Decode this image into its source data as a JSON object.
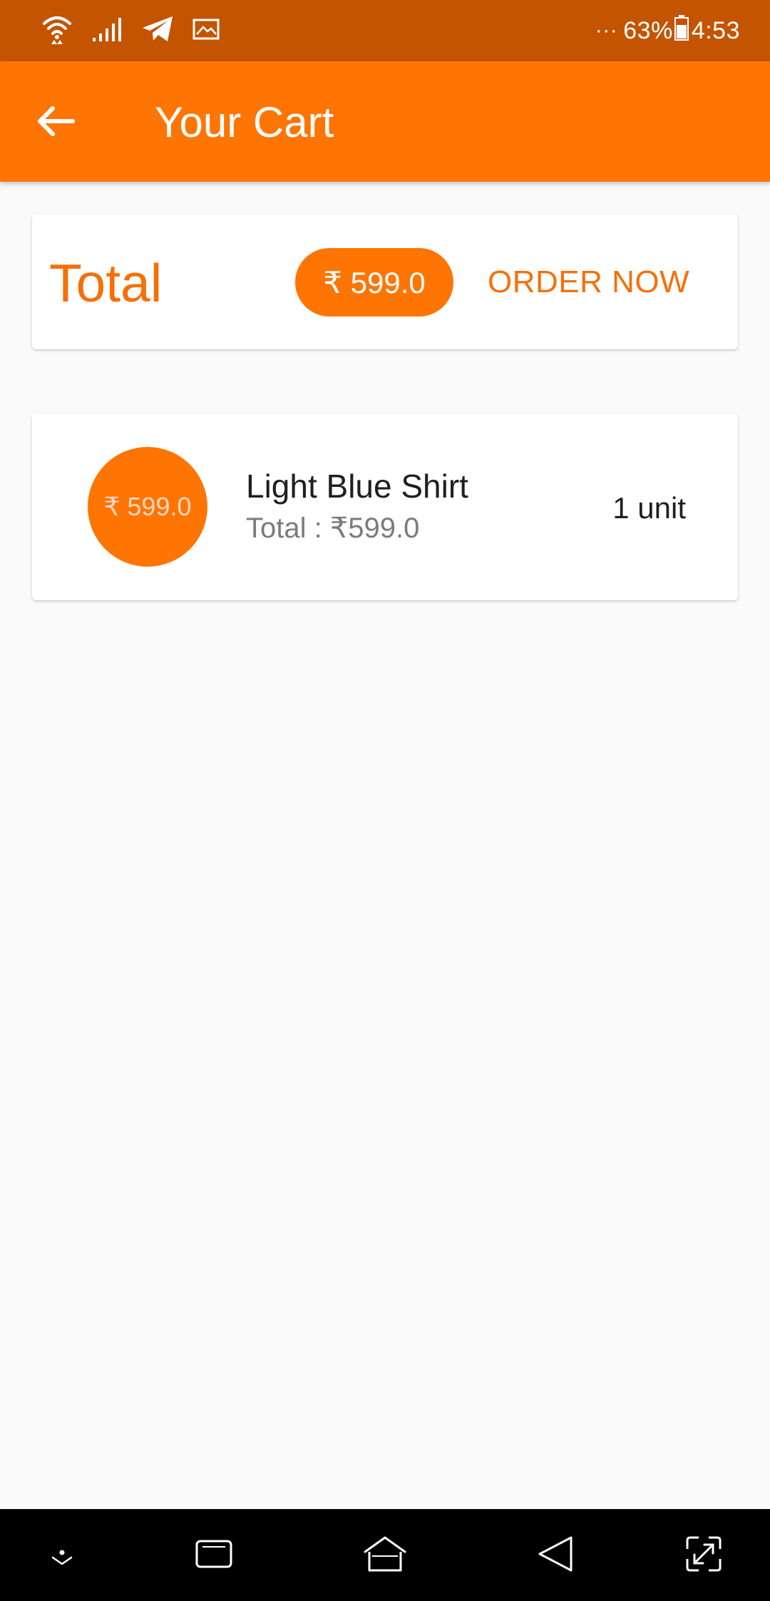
{
  "status_bar": {
    "battery_percent": "63%",
    "time": "4:53",
    "more_indicator": "···",
    "icons": [
      "wifi-icon",
      "signal-icon",
      "telegram-icon",
      "image-notification-icon",
      "battery-icon"
    ]
  },
  "app_bar": {
    "title": "Your Cart",
    "back_icon": "arrow-left-icon"
  },
  "total_card": {
    "label": "Total",
    "amount": "₹ 599.0",
    "order_button": "ORDER NOW"
  },
  "cart_items": [
    {
      "price_badge": "₹ 599.0",
      "name": "Light Blue Shirt",
      "total": "Total : ₹599.0",
      "quantity": "1 unit"
    }
  ],
  "nav_bar": {
    "icons": [
      "hide-nav-icon",
      "recent-apps-icon",
      "home-icon",
      "back-icon",
      "screen-expand-icon"
    ]
  },
  "colors": {
    "status_bar": "#c45400",
    "primary": "#ff7504",
    "accent_text": "#f57008",
    "background": "#fafafa"
  }
}
